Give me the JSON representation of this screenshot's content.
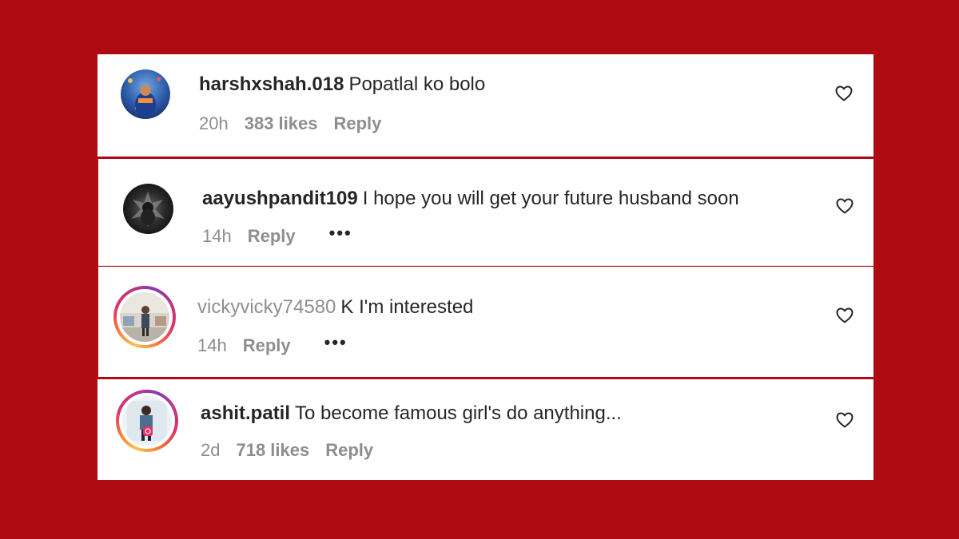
{
  "colors": {
    "background": "#ad0a12",
    "card": "#ffffff",
    "text": "#262626",
    "muted": "#8e8e8e"
  },
  "comments": [
    {
      "username": "harshxshah.018",
      "text": "Popatlal ko bolo",
      "time": "20h",
      "likes": "383 likes",
      "reply": "Reply",
      "has_story_ring": false,
      "more_icon": false
    },
    {
      "username": "aayushpandit109",
      "text": "I hope you will get your future husband soon",
      "time": "14h",
      "likes": "",
      "reply": "Reply",
      "has_story_ring": false,
      "more_icon": true
    },
    {
      "username": "vickyvicky74580",
      "text": "K I'm interested",
      "time": "14h",
      "likes": "",
      "reply": "Reply",
      "has_story_ring": true,
      "more_icon": true
    },
    {
      "username": "ashit.patil",
      "text": "To become famous girl's do anything...",
      "time": "2d",
      "likes": "718 likes",
      "reply": "Reply",
      "has_story_ring": true,
      "more_icon": false
    }
  ],
  "icons": {
    "like": "heart-icon",
    "more": "more-options-icon"
  }
}
